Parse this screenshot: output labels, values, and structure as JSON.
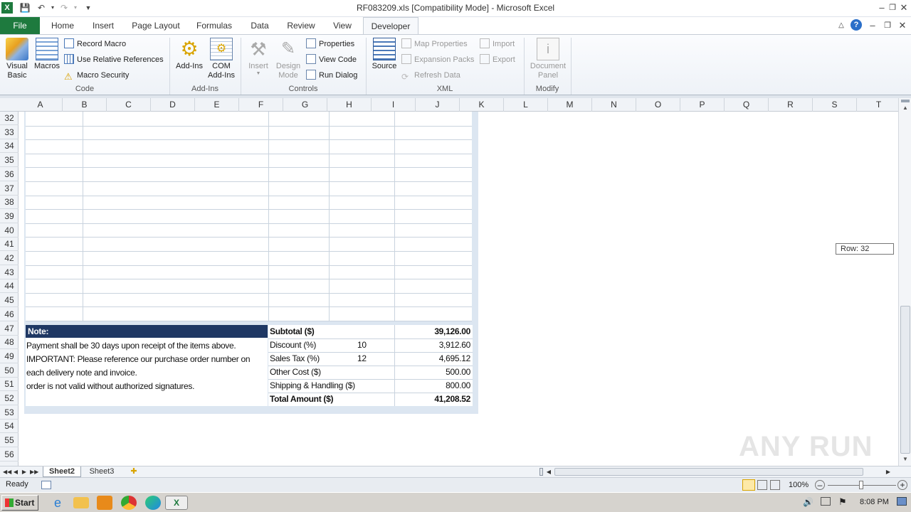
{
  "window": {
    "title": "RF083209.xls  [Compatibility Mode]  -  Microsoft Excel"
  },
  "tabs": [
    "File",
    "Home",
    "Insert",
    "Page Layout",
    "Formulas",
    "Data",
    "Review",
    "View",
    "Developer"
  ],
  "ribbon": {
    "code": {
      "label": "Code",
      "visual_basic": "Visual\nBasic",
      "macros": "Macros",
      "record_macro": "Record Macro",
      "relative_refs": "Use Relative References",
      "macro_security": "Macro Security"
    },
    "addins": {
      "label": "Add-Ins",
      "addins": "Add-Ins",
      "com_addins": "COM\nAdd-Ins"
    },
    "controls": {
      "label": "Controls",
      "insert": "Insert",
      "design_mode": "Design\nMode",
      "properties": "Properties",
      "view_code": "View Code",
      "run_dialog": "Run Dialog"
    },
    "xml": {
      "label": "XML",
      "source": "Source",
      "map_properties": "Map Properties",
      "expansion_packs": "Expansion Packs",
      "refresh_data": "Refresh Data",
      "import": "Import",
      "export": "Export"
    },
    "modify": {
      "label": "Modify",
      "document_panel": "Document\nPanel"
    }
  },
  "columns": [
    "A",
    "B",
    "C",
    "D",
    "E",
    "F",
    "G",
    "H",
    "I",
    "J",
    "K",
    "L",
    "M",
    "N",
    "O",
    "P",
    "Q",
    "R",
    "S",
    "T"
  ],
  "rows": [
    "32",
    "33",
    "34",
    "35",
    "36",
    "37",
    "38",
    "39",
    "40",
    "41",
    "42",
    "43",
    "44",
    "45",
    "46",
    "47",
    "48",
    "49",
    "50",
    "51",
    "52",
    "53",
    "54",
    "55",
    "56"
  ],
  "note": {
    "header": "Note:",
    "lines": [
      "Payment shall be 30 days upon receipt of the items above.",
      "IMPORTANT: Please reference our purchase order number on",
      "each delivery note and invoice.",
      "order is not valid without authorized signatures."
    ]
  },
  "totals": [
    {
      "label": "Subtotal ($)",
      "rate": "",
      "amount": "39,126.00",
      "bold": true
    },
    {
      "label": "Discount (%)",
      "rate": "10",
      "amount": "3,912.60",
      "bold": false
    },
    {
      "label": "Sales Tax (%)",
      "rate": "12",
      "amount": "4,695.12",
      "bold": false
    },
    {
      "label": "Other Cost ($)",
      "rate": "",
      "amount": "500.00",
      "bold": false
    },
    {
      "label": "Shipping & Handling ($)",
      "rate": "",
      "amount": "800.00",
      "bold": false
    },
    {
      "label": "Total Amount ($)",
      "rate": "",
      "amount": "41,208.52",
      "bold": true
    }
  ],
  "row_tip": "Row: 32",
  "sheets": [
    "Sheet2",
    "Sheet3"
  ],
  "status": {
    "ready": "Ready",
    "zoom": "100%"
  },
  "taskbar": {
    "start": "Start",
    "clock": "8:08 PM"
  },
  "watermark": "ANY RUN",
  "colors": {
    "file_tab": "#1e7a3e",
    "note_header": "#1f3864",
    "form_bg": "#dce6f1"
  }
}
